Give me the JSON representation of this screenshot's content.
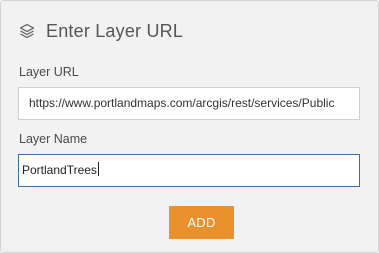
{
  "dialog": {
    "title": "Enter Layer URL",
    "title_icon": "layers-icon"
  },
  "layer_url": {
    "label": "Layer URL",
    "value": "https://www.portlandmaps.com/arcgis/rest/services/Public"
  },
  "layer_name": {
    "label": "Layer Name",
    "value": "PortlandTrees"
  },
  "actions": {
    "add_label": "ADD"
  },
  "colors": {
    "panel_background": "#f2f2f2",
    "add_button": "#e8912d",
    "focused_border": "#3b6ea5"
  }
}
